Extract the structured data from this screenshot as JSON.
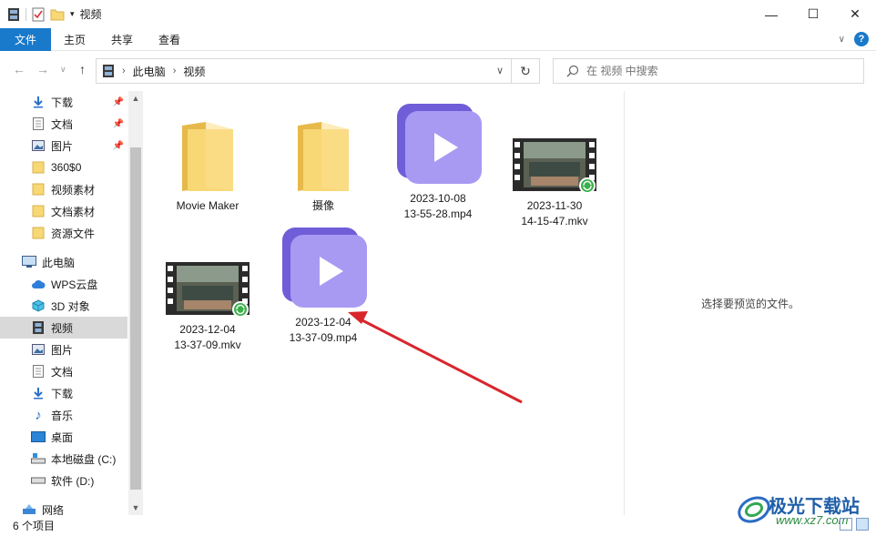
{
  "window": {
    "title": "视频",
    "controls": {
      "minimize": "—",
      "maximize": "☐",
      "close": "✕"
    }
  },
  "ribbon": {
    "tabs": [
      "文件",
      "主页",
      "共享",
      "查看"
    ],
    "help": "?"
  },
  "address": {
    "crumbs": [
      "此电脑",
      "视频"
    ],
    "search_placeholder": "在 视频 中搜索"
  },
  "sidebar": {
    "items": [
      {
        "label": "下载",
        "icon": "download-icon",
        "pinned": true
      },
      {
        "label": "文档",
        "icon": "document-icon",
        "pinned": true
      },
      {
        "label": "图片",
        "icon": "picture-icon",
        "pinned": true
      },
      {
        "label": "360$0",
        "icon": "folder-icon"
      },
      {
        "label": "视频素材",
        "icon": "folder-icon"
      },
      {
        "label": "文档素材",
        "icon": "folder-icon"
      },
      {
        "label": "资源文件",
        "icon": "folder-icon"
      },
      {
        "label": "此电脑",
        "icon": "computer-icon"
      },
      {
        "label": "WPS云盘",
        "icon": "cloud-icon"
      },
      {
        "label": "3D 对象",
        "icon": "cube-icon"
      },
      {
        "label": "视频",
        "icon": "video-icon",
        "selected": true
      },
      {
        "label": "图片",
        "icon": "picture-icon"
      },
      {
        "label": "文档",
        "icon": "document-icon"
      },
      {
        "label": "下载",
        "icon": "download-icon"
      },
      {
        "label": "音乐",
        "icon": "music-icon"
      },
      {
        "label": "桌面",
        "icon": "desktop-icon"
      },
      {
        "label": "本地磁盘 (C:)",
        "icon": "drive-icon"
      },
      {
        "label": "软件 (D:)",
        "icon": "drive-icon"
      },
      {
        "label": "网络",
        "icon": "network-icon"
      }
    ]
  },
  "files": [
    {
      "name": "Movie Maker",
      "type": "folder"
    },
    {
      "name": "摄像",
      "type": "folder"
    },
    {
      "name_line1": "2023-10-08",
      "name_line2": "13-55-28.mp4",
      "type": "mp4"
    },
    {
      "name_line1": "2023-11-30",
      "name_line2": "14-15-47.mkv",
      "type": "mkv"
    },
    {
      "name_line1": "2023-12-04",
      "name_line2": "13-37-09.mkv",
      "type": "mkv"
    },
    {
      "name_line1": "2023-12-04",
      "name_line2": "13-37-09.mp4",
      "type": "mp4"
    }
  ],
  "preview": {
    "message": "选择要预览的文件。"
  },
  "status": {
    "count": "6 个项目"
  },
  "watermark": {
    "line1": "极光下载站",
    "line2": "www.xz7.com"
  },
  "colors": {
    "accent": "#1979ca",
    "folder": "#f8d775",
    "video_purple": "#9b8cf0",
    "arrow": "#d9262b"
  }
}
